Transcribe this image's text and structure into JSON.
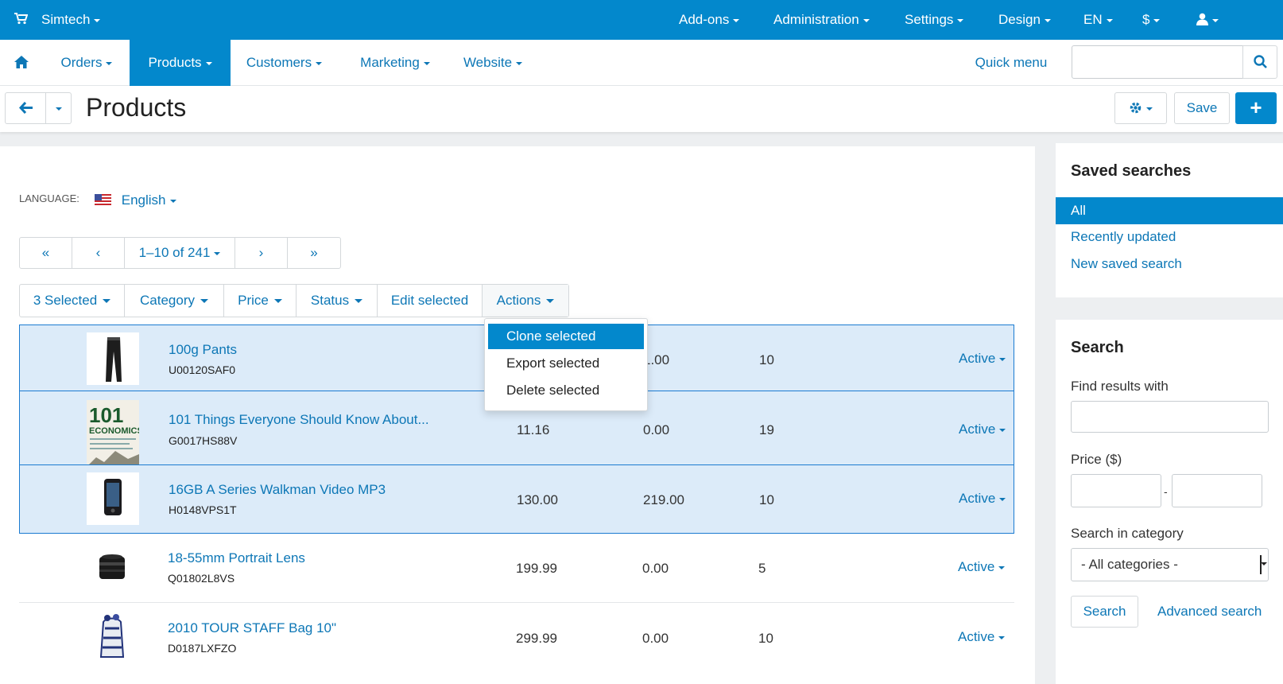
{
  "topbar": {
    "store": "Simtech",
    "menus": [
      "Add-ons",
      "Administration",
      "Settings",
      "Design",
      "EN",
      "$"
    ],
    "color": "#0388cc"
  },
  "nav": {
    "items": [
      "Orders",
      "Products",
      "Customers",
      "Marketing",
      "Website"
    ],
    "active": "Products",
    "quick_menu": "Quick menu",
    "search_value": ""
  },
  "header": {
    "title": "Products",
    "save": "Save"
  },
  "filters": {
    "language_label": "LANGUAGE:",
    "language": "English"
  },
  "pagination": {
    "range": "1–10 of 241"
  },
  "toolbar": {
    "selected": "3 Selected",
    "category": "Category",
    "price": "Price",
    "status": "Status",
    "edit_selected": "Edit selected",
    "actions": "Actions"
  },
  "actions_menu": {
    "items": [
      "Clone selected",
      "Export selected",
      "Delete selected"
    ],
    "highlighted": "Clone selected"
  },
  "products": [
    {
      "name": "100g Pants",
      "code": "U00120SAF0",
      "price": "",
      "list_price": "1.00",
      "qty": "10",
      "status": "Active",
      "selected": true,
      "image": "pants"
    },
    {
      "name": "101 Things Everyone Should Know About...",
      "code": "G0017HS88V",
      "price": "11.16",
      "list_price": "0.00",
      "qty": "19",
      "status": "Active",
      "selected": true,
      "image": "book",
      "image_text": "101",
      "image_subtext": "ECONOMICS"
    },
    {
      "name": "16GB A Series Walkman Video MP3",
      "code": "H0148VPS1T",
      "price": "130.00",
      "list_price": "219.00",
      "qty": "10",
      "status": "Active",
      "selected": true,
      "image": "mp3-player"
    },
    {
      "name": "18-55mm Portrait Lens",
      "code": "Q01802L8VS",
      "price": "199.99",
      "list_price": "0.00",
      "qty": "5",
      "status": "Active",
      "selected": false,
      "image": "lens"
    },
    {
      "name": "2010 TOUR STAFF Bag 10\"",
      "code": "D0187LXFZO",
      "price": "299.99",
      "list_price": "0.00",
      "qty": "10",
      "status": "Active",
      "selected": false,
      "image": "golf-bag"
    }
  ],
  "sidebar": {
    "saved_title": "Saved searches",
    "saved_items": [
      "All",
      "Recently updated",
      "New saved search"
    ],
    "search_title": "Search",
    "find_label": "Find results with",
    "find_value": "",
    "price_label": "Price ($)",
    "price_dash": "-",
    "price_from": "",
    "price_to": "",
    "category_label": "Search in category",
    "category_value": "- All categories -",
    "search_button": "Search",
    "advanced": "Advanced search"
  }
}
